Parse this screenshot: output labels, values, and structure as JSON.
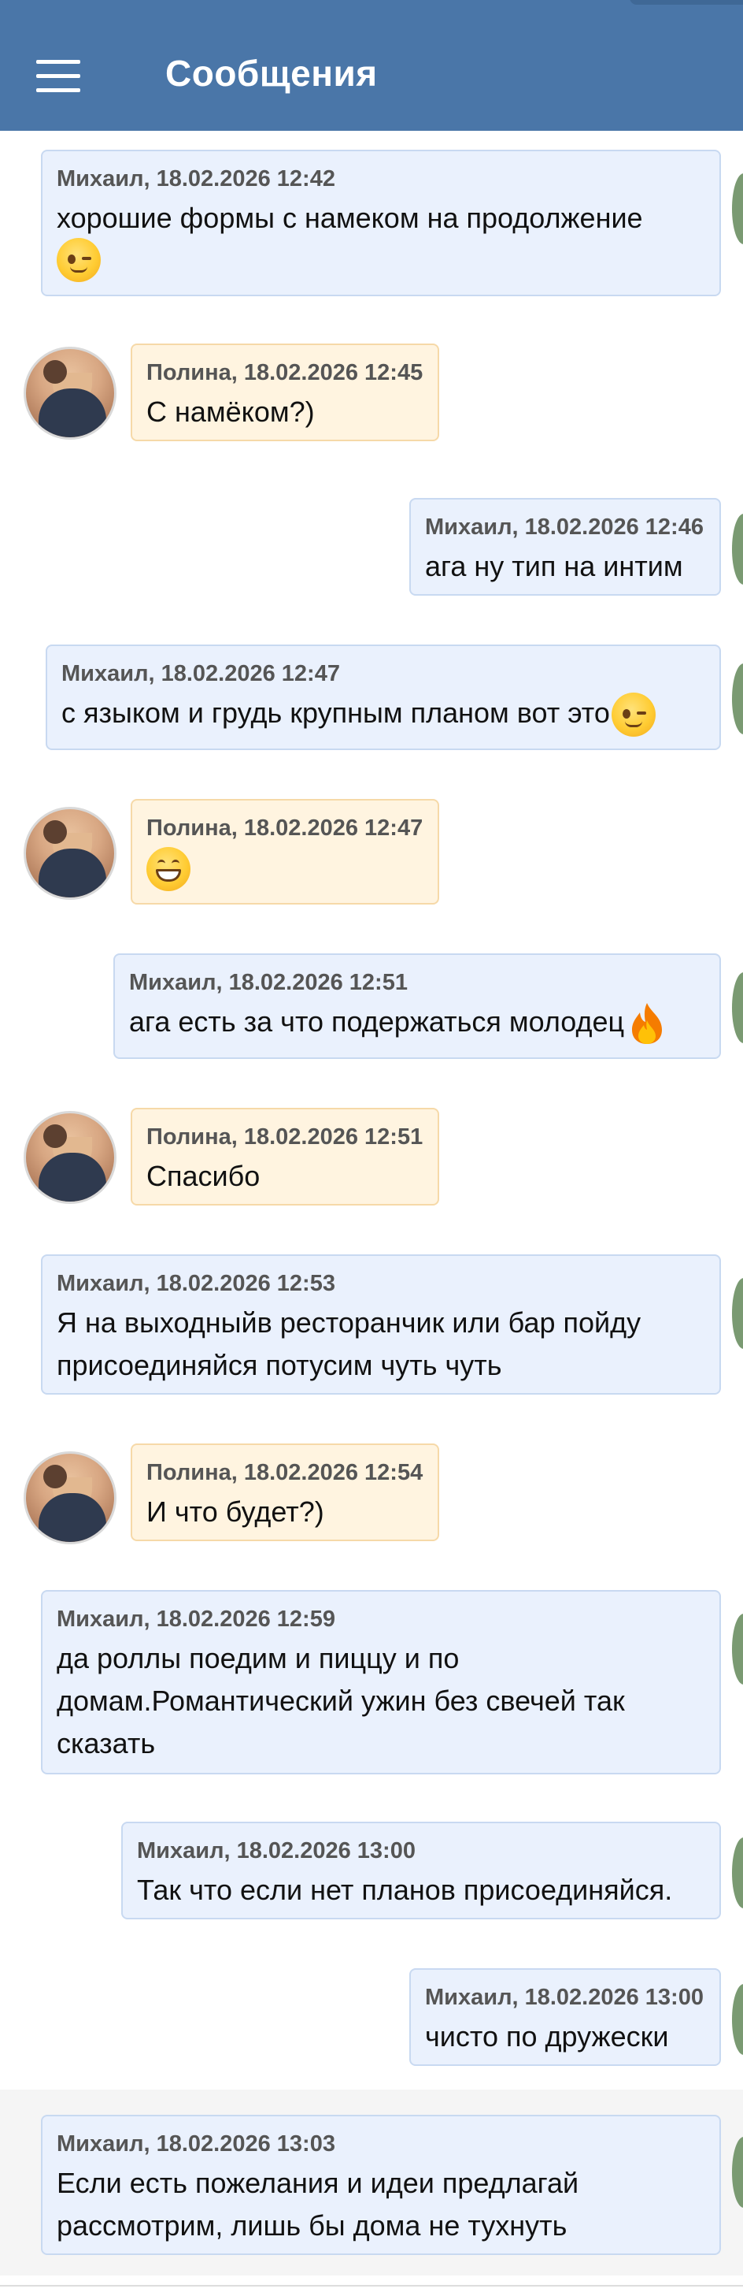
{
  "header": {
    "title": "Сообщения"
  },
  "messages": [
    {
      "author": "Михаил",
      "time": "18.02.2026 12:42",
      "meta": "Михаил, 18.02.2026 12:42",
      "text": "хорошие формы с намеком на продолжение",
      "emoji": "wink-icon"
    },
    {
      "author": "Полина",
      "time": "18.02.2026 12:45",
      "meta": "Полина, 18.02.2026 12:45",
      "text": "С намёком?)"
    },
    {
      "author": "Михаил",
      "time": "18.02.2026 12:46",
      "meta": "Михаил, 18.02.2026 12:46",
      "text": "ага ну тип на интим"
    },
    {
      "author": "Михаил",
      "time": "18.02.2026 12:47",
      "meta": "Михаил, 18.02.2026 12:47",
      "text": "с языком и грудь крупным планом вот это",
      "emoji": "wink-icon"
    },
    {
      "author": "Полина",
      "time": "18.02.2026 12:47",
      "meta": "Полина, 18.02.2026 12:47",
      "text": "",
      "emoji": "grin-icon"
    },
    {
      "author": "Михаил",
      "time": "18.02.2026 12:51",
      "meta": "Михаил, 18.02.2026 12:51",
      "text": "ага есть за что подержаться молодец",
      "emoji": "fire-icon"
    },
    {
      "author": "Полина",
      "time": "18.02.2026 12:51",
      "meta": "Полина, 18.02.2026 12:51",
      "text": "Спасибо"
    },
    {
      "author": "Михаил",
      "time": "18.02.2026 12:53",
      "meta": "Михаил, 18.02.2026 12:53",
      "text": "Я на выходныйв ресторанчик или бар пойду присоединяйся потусим чуть чуть"
    },
    {
      "author": "Полина",
      "time": "18.02.2026 12:54",
      "meta": "Полина, 18.02.2026 12:54",
      "text": "И что будет?)"
    },
    {
      "author": "Михаил",
      "time": "18.02.2026 12:59",
      "meta": "Михаил, 18.02.2026 12:59",
      "text": "да роллы поедим и пиццу и по домам.Романтический ужин без свечей так сказать"
    },
    {
      "author": "Михаил",
      "time": "18.02.2026 13:00",
      "meta": "Михаил, 18.02.2026 13:00",
      "text": "Так что если нет планов присоединяйся."
    },
    {
      "author": "Михаил",
      "time": "18.02.2026 13:00",
      "meta": "Михаил, 18.02.2026 13:00",
      "text": "чисто по дружески"
    },
    {
      "author": "Михаил",
      "time": "18.02.2026 13:03",
      "meta": "Михаил, 18.02.2026 13:03",
      "text": "Если есть пожелания и идеи предлагай рассмотрим, лишь бы дома не тухнуть"
    }
  ],
  "colors": {
    "header_bg": "#4a76a8",
    "own_bubble_bg": "#eaf1fd",
    "other_bubble_bg": "#fff4e0"
  }
}
